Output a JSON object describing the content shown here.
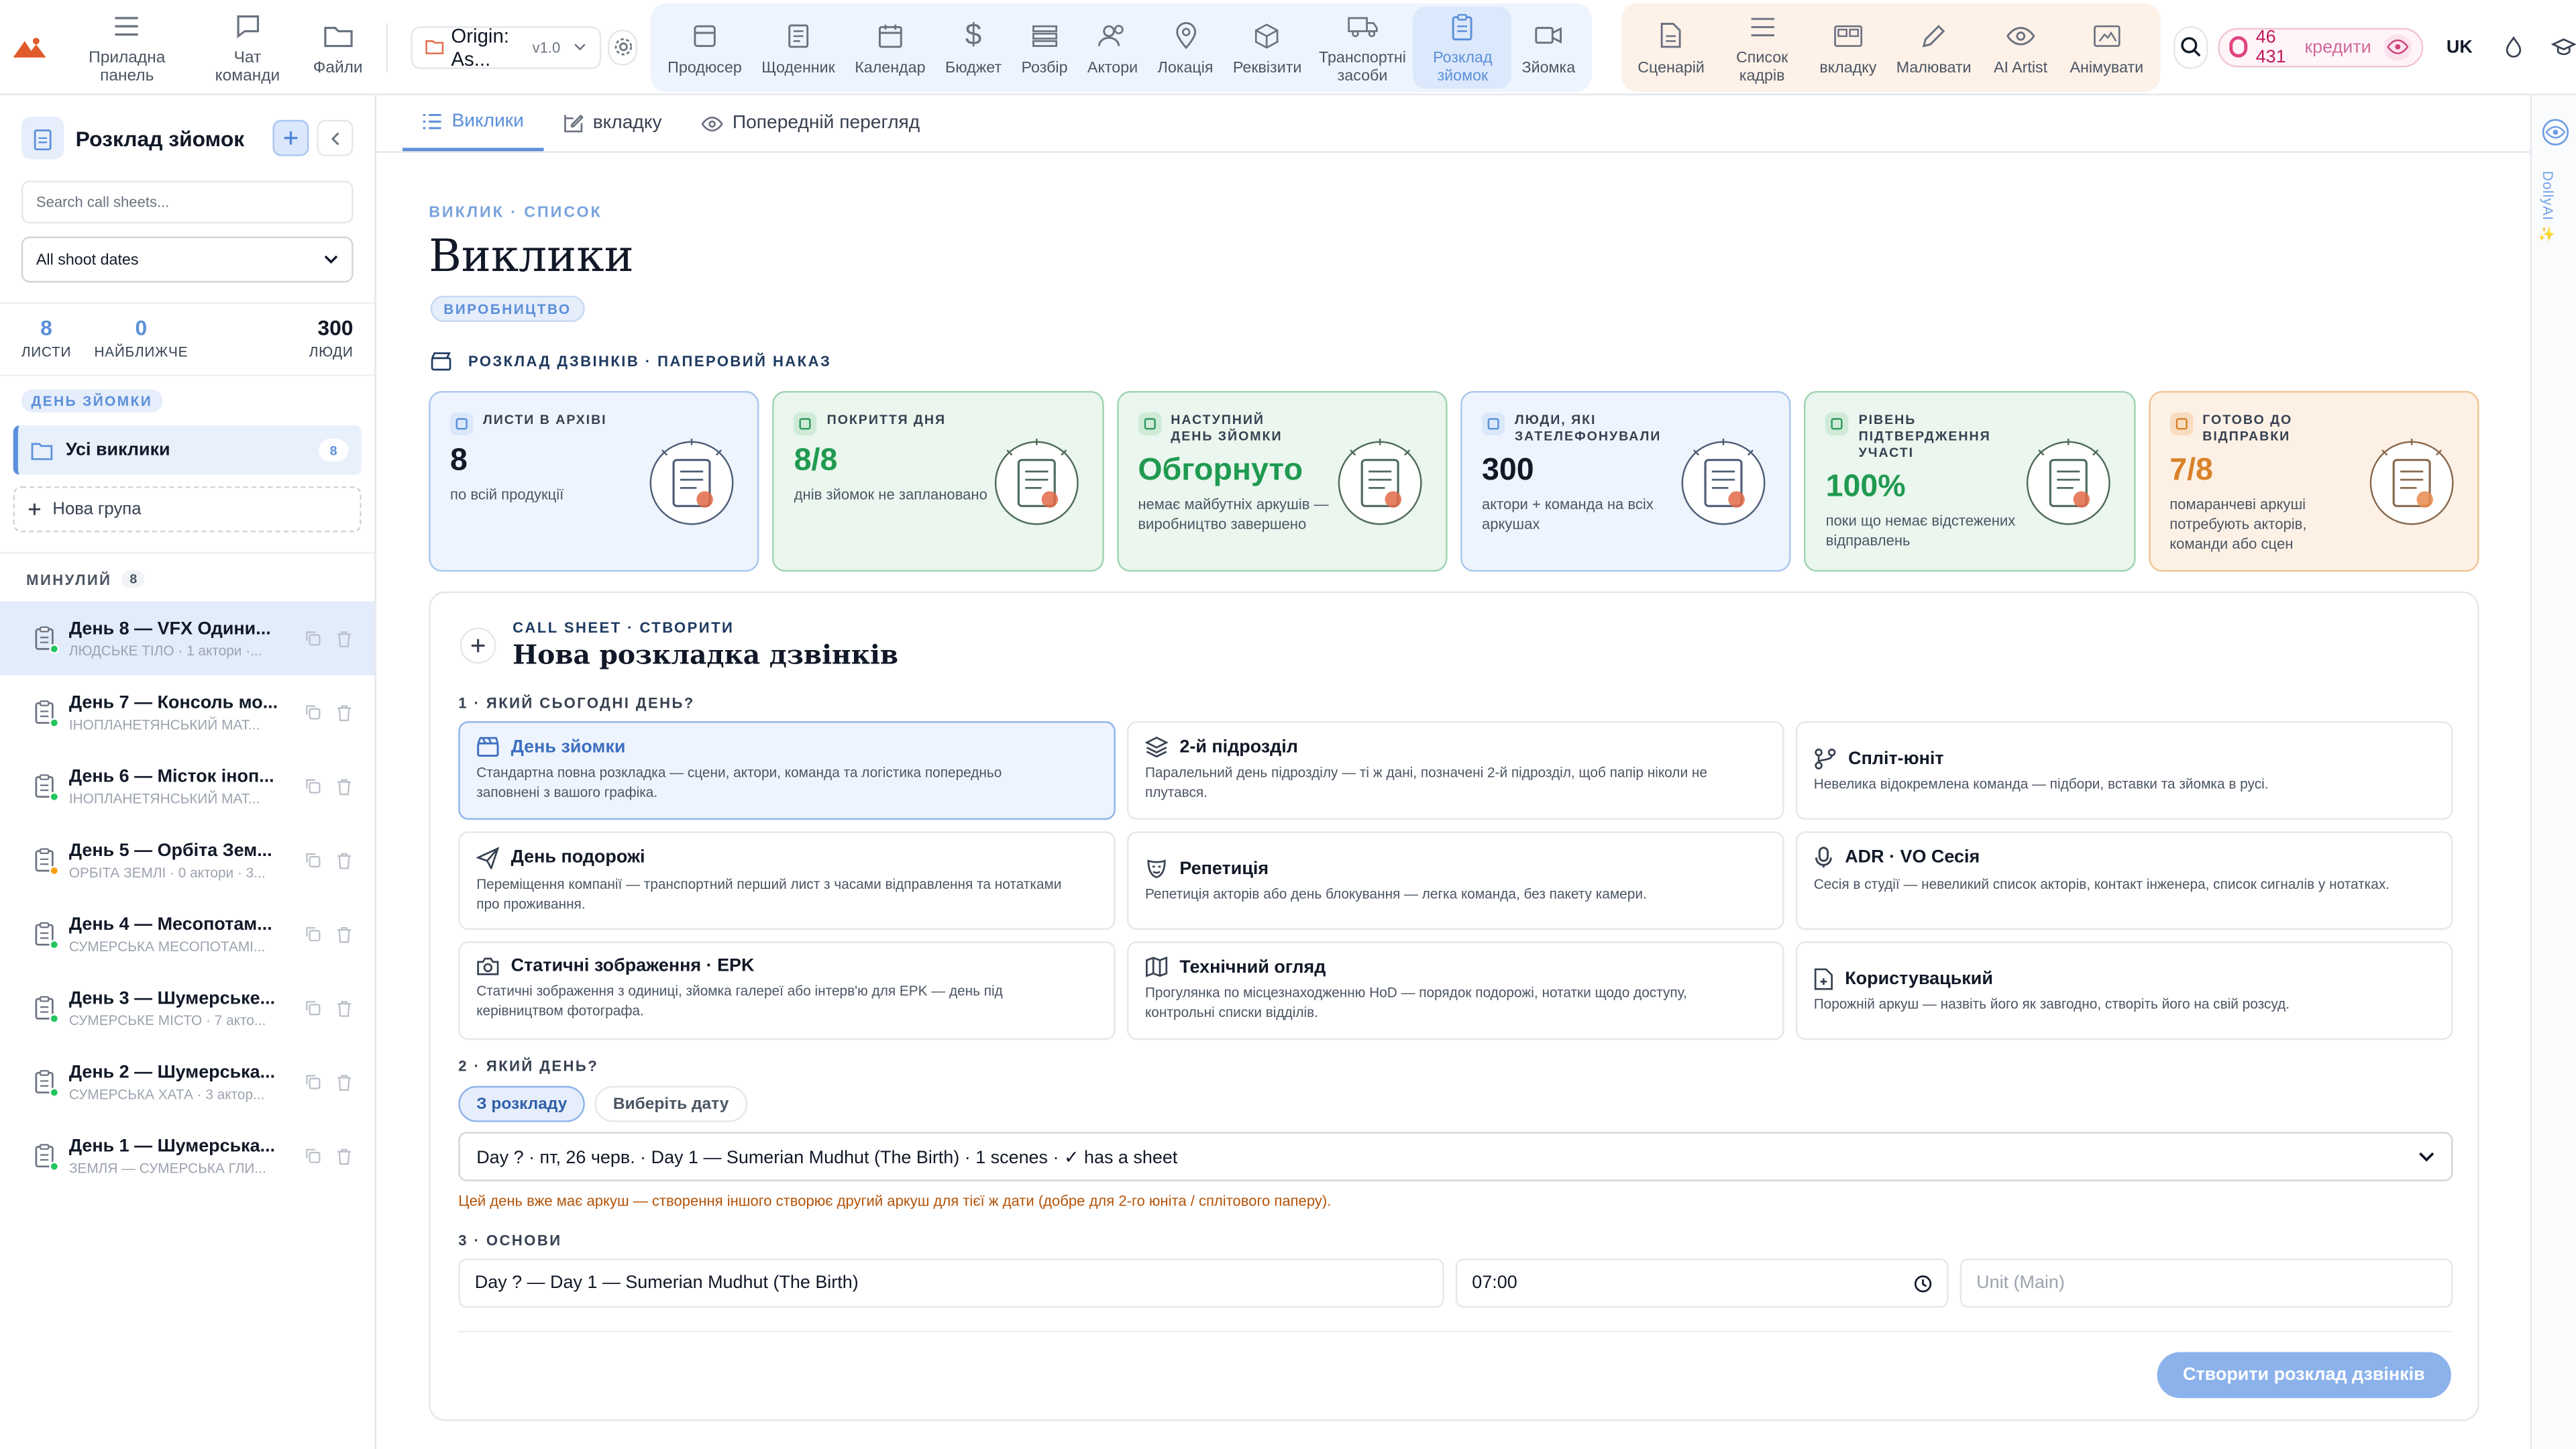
{
  "topbar": {
    "nav_left": [
      {
        "label": "Приладна панель",
        "icon": "menu-icon"
      },
      {
        "label": "Чат команди",
        "icon": "chat-icon"
      },
      {
        "label": "Файли",
        "icon": "folder-icon"
      }
    ],
    "project": {
      "name": "Origin: As...",
      "version": "v1.0"
    },
    "nav_blue": [
      {
        "label": "Продюсер",
        "icon": "film-icon"
      },
      {
        "label": "Щоденник",
        "icon": "notebook-icon"
      },
      {
        "label": "Календар",
        "icon": "calendar-icon"
      },
      {
        "label": "Бюджет",
        "icon": "dollar-icon"
      },
      {
        "label": "Розбір",
        "icon": "layers-icon"
      },
      {
        "label": "Актори",
        "icon": "users-icon"
      },
      {
        "label": "Локація",
        "icon": "pin-icon"
      },
      {
        "label": "Реквізити",
        "icon": "box-icon"
      },
      {
        "label": "Транспортні засоби",
        "icon": "truck-icon"
      },
      {
        "label": "Розклад зйомок",
        "icon": "clipboard-icon",
        "active": true
      },
      {
        "label": "Зйомка",
        "icon": "video-icon"
      }
    ],
    "nav_orange": [
      {
        "label": "Сценарій",
        "icon": "script-icon"
      },
      {
        "label": "Список кадрів",
        "icon": "list-icon"
      },
      {
        "label": "вкладку",
        "icon": "storyboard-icon"
      },
      {
        "label": "Малювати",
        "icon": "pencil-icon"
      },
      {
        "label": "AI Artist",
        "icon": "eye-icon"
      },
      {
        "label": "Анімувати",
        "icon": "animate-icon"
      }
    ],
    "credits": {
      "value": "46 431",
      "label": "кредити"
    },
    "language": "UK"
  },
  "sidebar": {
    "title": "Розклад зйомок",
    "search_placeholder": "Search call sheets...",
    "date_filter": "All shoot dates",
    "stats": [
      {
        "value": "8",
        "label": "ЛИСТИ"
      },
      {
        "value": "0",
        "label": "НАЙБЛИЖЧЕ"
      },
      {
        "value": "300",
        "label": "ЛЮДИ"
      }
    ],
    "section_label": "ДЕНЬ ЗЙОМКИ",
    "all_calls": {
      "label": "Усі виклики",
      "count": "8"
    },
    "new_group": "Нова група",
    "past": {
      "label": "МИНУЛИЙ",
      "count": "8"
    },
    "days": [
      {
        "title": "День 8 — VFX Одини...",
        "sub": "ЛЮДСЬКЕ ТІЛО · 1 актори ·...",
        "status": "green",
        "active": true
      },
      {
        "title": "День 7 — Консоль мо...",
        "sub": "ІНОПЛАНЕТЯНСЬКИЙ МАТ...",
        "status": "green"
      },
      {
        "title": "День 6 — Місток іноп...",
        "sub": "ІНОПЛАНЕТЯНСЬКИЙ МАТ...",
        "status": "green"
      },
      {
        "title": "День 5 — Орбіта Зем...",
        "sub": "ОРБІТА ЗЕМЛІ · 0 актори · 3...",
        "status": "orange"
      },
      {
        "title": "День 4 — Месопотам...",
        "sub": "СУМЕРСЬКА МЕСОПОТАМІ...",
        "status": "green"
      },
      {
        "title": "День 3 — Шумерське...",
        "sub": "СУМЕРСЬКЕ МІСТО · 7 акто...",
        "status": "green"
      },
      {
        "title": "День 2 — Шумерська...",
        "sub": "СУМЕРСЬКА ХАТА · 3 актор...",
        "status": "green"
      },
      {
        "title": "День 1 — Шумерська...",
        "sub": "ЗЕМЛЯ — СУМЕРСЬКА ГЛИ...",
        "status": "green"
      }
    ]
  },
  "tabs": [
    {
      "label": "Виклики",
      "icon": "list-icon",
      "active": true
    },
    {
      "label": "вкладку",
      "icon": "edit-icon"
    },
    {
      "label": "Попередній перегляд",
      "icon": "eye-icon"
    }
  ],
  "rail": {
    "label": "DollyAI ✨"
  },
  "main": {
    "crumb": "ВИКЛИК · СПИСОК",
    "title": "Виклики",
    "pill": "ВИРОБНИЦТВО",
    "section_title": "РОЗКЛАД ДЗВІНКІВ · ПАПЕРОВИЙ НАКАЗ",
    "cards": [
      {
        "head": "ЛИСТИ В АРХІВІ",
        "value": "8",
        "sub": "по всій продукції",
        "tone": "blue"
      },
      {
        "head": "ПОКРИТТЯ ДНЯ",
        "value": "8/8",
        "sub": "днів зйомок не заплановано",
        "tone": "green"
      },
      {
        "head": "НАСТУПНИЙ ДЕНЬ ЗЙОМКИ",
        "value": "Обгорнуто",
        "sub": "немає майбутніх аркушів — виробництво завершено",
        "tone": "green"
      },
      {
        "head": "ЛЮДИ, ЯКІ ЗАТЕЛЕФОНУВАЛИ",
        "value": "300",
        "sub": "актори + команда на всіх аркушах",
        "tone": "blue"
      },
      {
        "head": "РІВЕНЬ ПІДТВЕРДЖЕННЯ УЧАСТІ",
        "value": "100%",
        "sub": "поки що немає відстежених відправлень",
        "tone": "green"
      },
      {
        "head": "ГОТОВО ДО ВІДПРАВКИ",
        "value": "7/8",
        "sub": "помаранчеві аркуші потребують акторів, команди або сцен",
        "tone": "orange"
      }
    ],
    "create": {
      "kicker": "CALL SHEET · СТВОРИТИ",
      "title": "Нова розкладка дзвінків",
      "q1": "1 · ЯКИЙ СЬОГОДНІ ДЕНЬ?",
      "types": [
        {
          "title": "День зйомки",
          "desc": "Стандартна повна розкладка — сцени, актори, команда та логістика попередньо заповнені з вашого графіка.",
          "icon": "clapper-icon",
          "selected": true
        },
        {
          "title": "2-й підрозділ",
          "desc": "Паралельний день підрозділу — ті ж дані, позначені 2-й підрозділ, щоб папір ніколи не плутався.",
          "icon": "layers-icon"
        },
        {
          "title": "Спліт-юніт",
          "desc": "Невелика відокремлена команда — підбори, вставки та зйомка в русі.",
          "icon": "split-icon"
        },
        {
          "title": "День подорожі",
          "desc": "Переміщення компанії — транспортний перший лист з часами відправлення та нотатками про проживання.",
          "icon": "plane-icon"
        },
        {
          "title": "Репетиція",
          "desc": "Репетиція акторів або день блокування — легка команда, без пакету камери.",
          "icon": "mask-icon"
        },
        {
          "title": "ADR · VO Сесія",
          "desc": "Сесія в студії — невеликий список акторів, контакт інженера, список сигналів у нотатках.",
          "icon": "mic-icon"
        },
        {
          "title": "Статичні зображення · EPK",
          "desc": "Статичні зображення з одиниці, зйомка галереї або інтерв'ю для EPK — день під керівництвом фотографа.",
          "icon": "camera-icon"
        },
        {
          "title": "Технічний огляд",
          "desc": "Прогулянка по місцезнаходженню HoD — порядок подорожі, нотатки щодо доступу, контрольні списки відділів.",
          "icon": "map-icon"
        },
        {
          "title": "Користувацький",
          "desc": "Порожній аркуш — назвіть його як завгодно, створіть його на свій розсуд.",
          "icon": "file-plus-icon"
        }
      ],
      "q2": "2 · ЯКИЙ ДЕНЬ?",
      "seg": [
        "З розкладу",
        "Виберіть дату"
      ],
      "day_select": "Day ? · пт, 26 черв. · Day 1 — Sumerian Mudhut (The Birth) · 1 scenes · ✓ has a sheet",
      "warning": "Цей день вже має аркуш — створення іншого створює другий аркуш для тієї ж дати (добре для 2-го юніта / сплітового паперу).",
      "q3": "3 · ОСНОВИ",
      "title_field": "Day ? — Day 1 — Sumerian Mudhut (The Birth)",
      "time_field": "07:00",
      "unit_placeholder": "Unit (Main)",
      "submit": "Створити розклад дзвінків"
    }
  }
}
